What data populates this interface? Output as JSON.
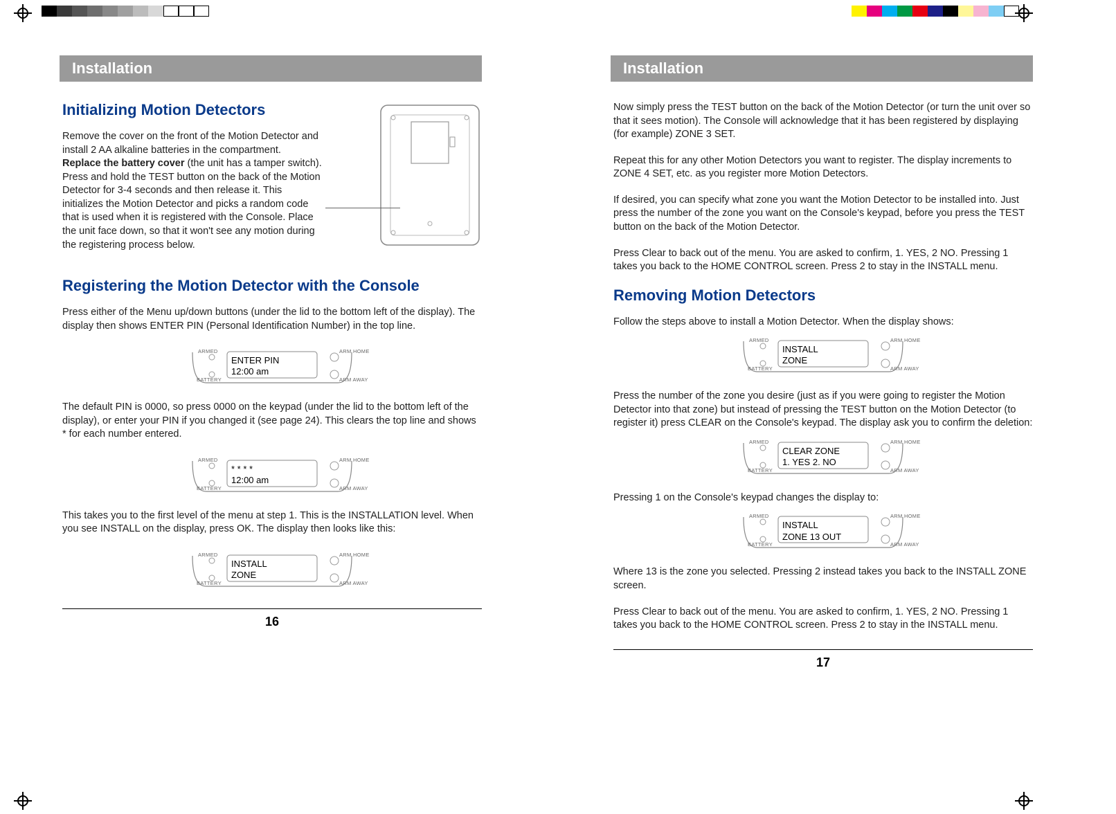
{
  "left": {
    "section": "Installation",
    "h1": "Initializing Motion Detectors",
    "p1a": "Remove the cover on the front of the Motion Detector and install 2 AA alkaline batteries in the compartment.",
    "p1b_bold": "Replace the battery cover",
    "p1b_rest": " (the unit has a tamper switch). Press and hold the TEST button on the back of the Motion Detector for 3-4 seconds and then release it. This initializes the Motion Detector and picks a random code that is used when it is registered with the Console. Place the unit face down, so that it won't see any motion during the registering process below.",
    "h2": "Registering the Motion Detector with the Console",
    "p2": "Press either of the Menu up/down buttons (under the lid to the bottom left of the display). The display then shows ENTER PIN (Personal Identification Number) in the top line.",
    "lcd1_l1": "ENTER PIN",
    "lcd1_l2": "12:00 am",
    "p3": "The default PIN is 0000, so press 0000 on the keypad (under the lid to the bottom left of the display), or enter your PIN if you changed it (see page 24). This clears the top line and shows * for each number entered.",
    "lcd2_l1": "* * * *",
    "lcd2_l2": "12:00 am",
    "p4": "This takes you to the first level of the menu at step 1. This is the INSTALLATION level. When you see INSTALL on the display, press OK. The display then looks like this:",
    "lcd3_l1": "INSTALL",
    "lcd3_l2": "ZONE",
    "page_num": "16"
  },
  "right": {
    "section": "Installation",
    "p1": "Now simply press the TEST button on the back of the Motion Detector (or turn the unit over so that it sees motion). The Console will acknowledge that it has been registered by displaying (for example) ZONE 3 SET.",
    "p2": "Repeat this for any other Motion Detectors you want to register. The display increments to ZONE 4 SET, etc. as you register more Motion Detectors.",
    "p3": "If desired, you can specify what zone you want the Motion Detector to be installed into. Just press the number of the zone you want on the Console's keypad, before you press the TEST button on the back of the Motion Detector.",
    "p4": "Press Clear to back out of the menu. You are asked to confirm, 1. YES, 2 NO. Pressing 1 takes you back to the HOME CONTROL screen. Press 2 to stay in the INSTALL menu.",
    "h1": "Removing Motion Detectors",
    "p5": "Follow the steps above to install a Motion Detector. When the display shows:",
    "lcd1_l1": "INSTALL",
    "lcd1_l2": "ZONE",
    "p6": "Press the number of the zone you desire (just as if you were going to register the Motion Detector into that zone) but instead of pressing the TEST button on the Motion Detector (to register it) press CLEAR on the Console's keypad. The display ask you to confirm the deletion:",
    "lcd2_l1": "CLEAR ZONE",
    "lcd2_l2": "1. YES 2. NO",
    "p7": "Pressing 1 on the Console's keypad changes the display to:",
    "lcd3_l1": "INSTALL",
    "lcd3_l2": "ZONE 13 OUT",
    "p8": "Where 13 is the zone you selected. Pressing 2 instead takes you back to the INSTALL ZONE screen.",
    "p9": "Press Clear to back out of the menu. You are asked to confirm, 1. YES, 2 NO. Pressing 1 takes you back to the HOME CONTROL screen. Press 2 to stay in the INSTALL menu.",
    "page_num": "17"
  },
  "lcd_labels": {
    "armed": "ARMED",
    "battery": "BATTERY",
    "arm_home": "ARM HOME",
    "arm_away": "ARM AWAY"
  }
}
